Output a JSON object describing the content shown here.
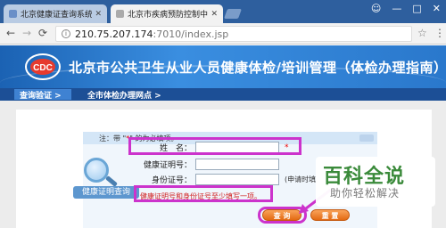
{
  "browser": {
    "tabs": [
      {
        "title": "北京健康证查询系统_百度..."
      },
      {
        "title": "北京市疾病预防控制中心"
      }
    ],
    "window_controls": {
      "profile_icon": "person-icon",
      "minimize": "—",
      "maximize": "□",
      "close": "✕"
    },
    "url": {
      "host": "210.75.207.174",
      "path": ":7010/index.jsp"
    }
  },
  "site": {
    "banner_title": "北京市公共卫生从业人员健康体检/培训管理（体检办理指南）",
    "nav": [
      "查询验证 >",
      "全市体检办理网点 >"
    ]
  },
  "form": {
    "note_prefix": "注：带 \"",
    "note_star": "*",
    "note_suffix": "\" 的为必填项。",
    "fields": [
      {
        "label": "姓　名：",
        "required": "*",
        "extra": ""
      },
      {
        "label": "健康证明号：",
        "required": "",
        "extra": ""
      },
      {
        "label": "身份证号：",
        "required": "",
        "extra": "(申请时填"
      }
    ],
    "badge_label": "健康证明查询",
    "hint": "健康证明号和身份证号至少填写一项。",
    "buttons": {
      "query": "查 询",
      "reset": "重 置"
    }
  },
  "watermark": {
    "title": "百科全说",
    "subtitle": "助你轻松解决"
  },
  "colors": {
    "tabbar": "#2e5f9e",
    "banner": "#2a78cc",
    "nav": "#1c4f96",
    "highlight": "#cc33cc",
    "button": "#e36a12"
  }
}
